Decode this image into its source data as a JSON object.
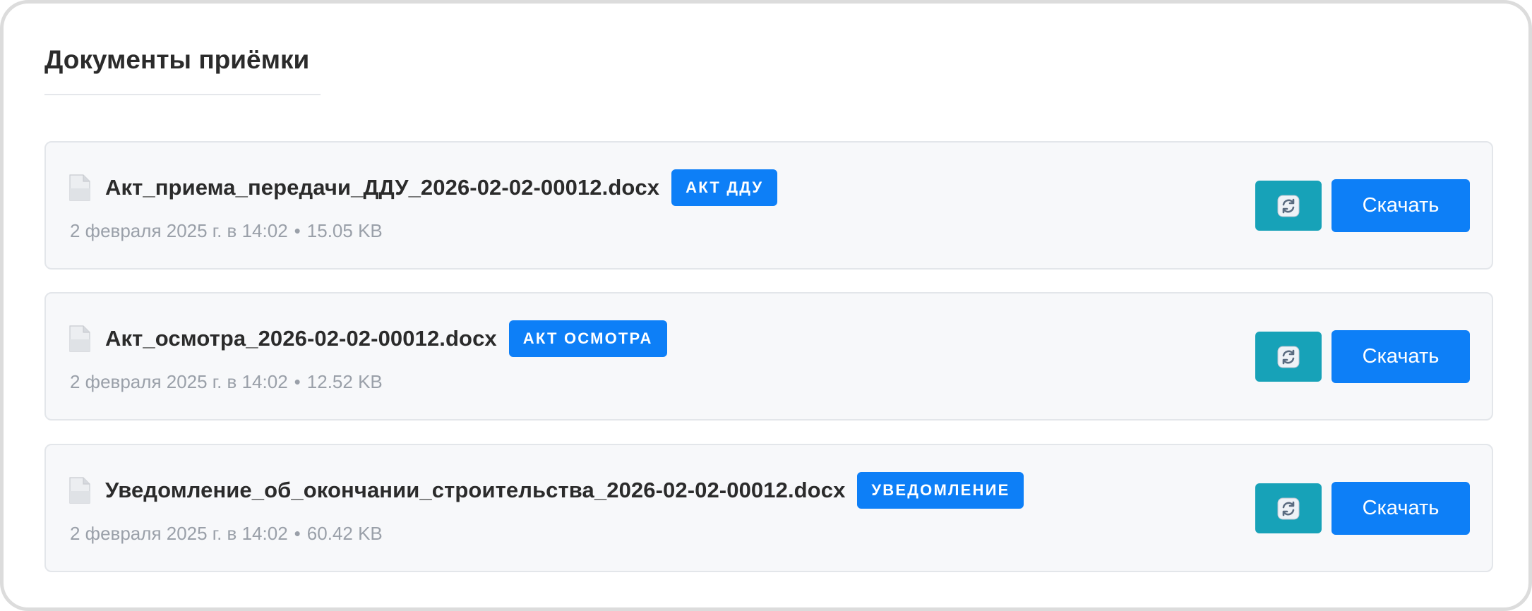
{
  "section": {
    "title": "Документы приёмки"
  },
  "documents": [
    {
      "file_name": "Акт_приема_передачи_ДДУ_2026-02-02-00012.docx",
      "badge": "АКТ ДДУ",
      "date": "2 февраля 2025 г. в 14:02",
      "separator": "•",
      "size": "15.05 KB",
      "icon": "file-icon",
      "refresh_icon": "refresh-icon",
      "download_label": "Скачать"
    },
    {
      "file_name": "Акт_осмотра_2026-02-02-00012.docx",
      "badge": "АКТ ОСМОТРА",
      "date": "2 февраля 2025 г. в 14:02",
      "separator": "•",
      "size": "12.52 KB",
      "icon": "file-icon",
      "refresh_icon": "refresh-icon",
      "download_label": "Скачать"
    },
    {
      "file_name": "Уведомление_об_окончании_строительства_2026-02-02-00012.docx",
      "badge": "УВЕДОМЛЕНИЕ",
      "date": "2 февраля 2025 г. в 14:02",
      "separator": "•",
      "size": "60.42 KB",
      "icon": "file-icon",
      "refresh_icon": "refresh-icon",
      "download_label": "Скачать"
    }
  ],
  "colors": {
    "accent": "#0d7ff7",
    "refresh": "#17a2b8",
    "card_bg": "#f7f8fa",
    "meta_text": "#9aa0a9"
  }
}
